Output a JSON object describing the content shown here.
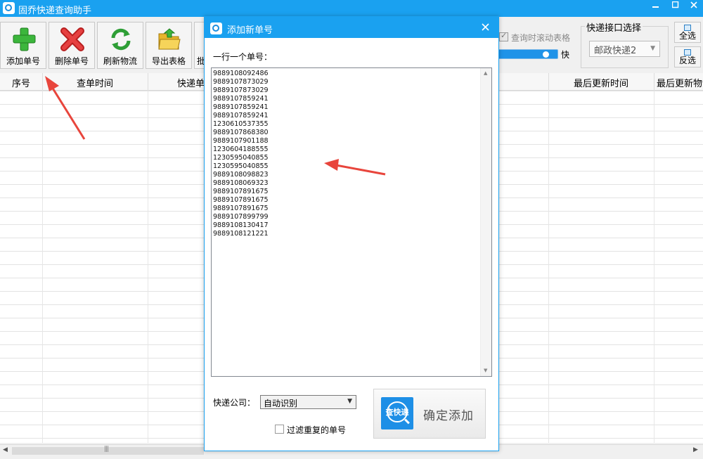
{
  "window": {
    "title": "固乔快递查询助手",
    "controls": {
      "minimize": "▫",
      "maximize": "▫",
      "close": "✕"
    }
  },
  "toolbar": {
    "buttons": [
      {
        "label": "添加单号",
        "icon": "plus-icon"
      },
      {
        "label": "删除单号",
        "icon": "delete-x-icon"
      },
      {
        "label": "刷新物流",
        "icon": "refresh-icon"
      },
      {
        "label": "导出表格",
        "icon": "folder-icon"
      },
      {
        "label": "批",
        "icon": "batch-icon"
      }
    ],
    "scroll_table_label": "查询时滚动表格",
    "scroll_table_checked": true,
    "speed_label": "快",
    "interface_group_title": "快递接口选择",
    "interface_selected": "邮政快递2",
    "select_all_label": "全选",
    "invert_select_label": "反选"
  },
  "table": {
    "columns": [
      "序号",
      "查单时间",
      "快递单号",
      "最后更新时间",
      "最后更新物流"
    ]
  },
  "dialog": {
    "title": "添加新单号",
    "close": "✕",
    "prompt": "一行一个单号：",
    "tracking_numbers": [
      "9889108092486",
      "9889107873029",
      "9889107873029",
      "9889107859241",
      "9889107859241",
      "9889107859241",
      "1230610537355",
      "9889107868380",
      "9889107901188",
      "1230604188555",
      "1230595040855",
      "1230595040855",
      "9889108098823",
      "9889108069323",
      "9889107891675",
      "9889107891675",
      "9889107891675",
      "9889107899799",
      "9889108130417",
      "9889108121221"
    ],
    "company_label": "快递公司：",
    "company_value": "自动识别",
    "filter_label": "过滤重复的单号",
    "filter_checked": false,
    "confirm_logo_text": "查快递",
    "confirm_label": "确定添加"
  },
  "colors": {
    "title_bar": "#1aa1f0",
    "annotation_arrow": "#e8453c"
  }
}
